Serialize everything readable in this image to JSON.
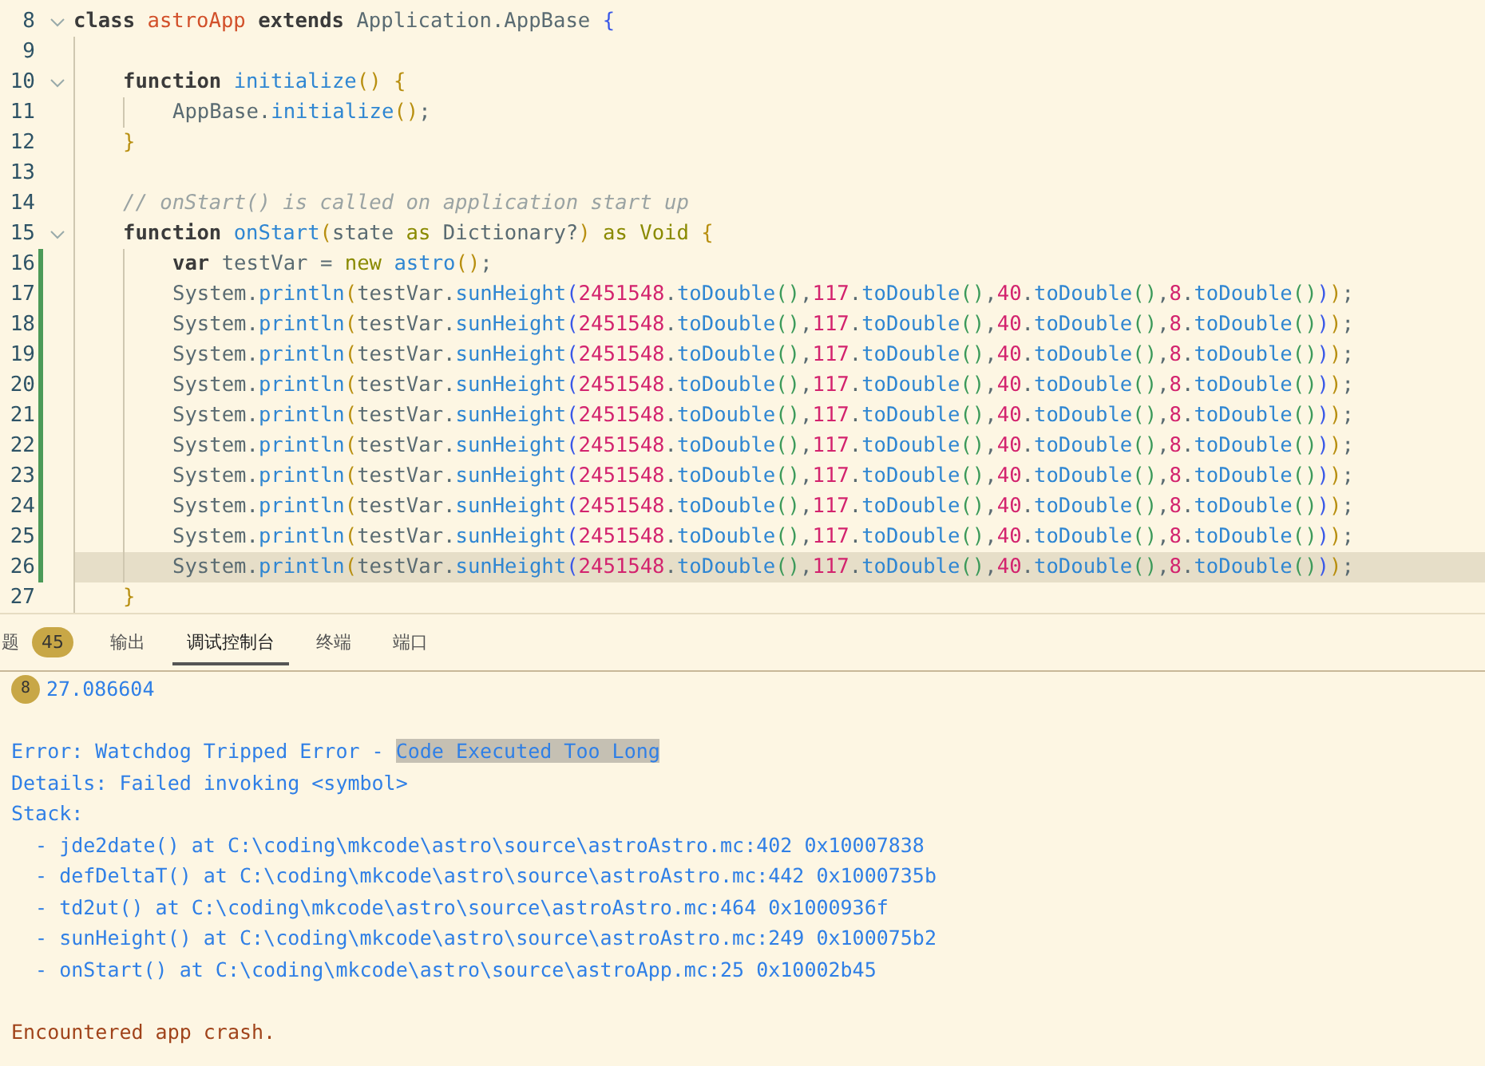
{
  "editor": {
    "lines": [
      {
        "number": "8",
        "fold": true,
        "modified": false,
        "current": false,
        "tokens": [
          {
            "text": "class ",
            "kind": "kw"
          },
          {
            "text": "astroApp ",
            "kind": "cls"
          },
          {
            "text": "extends",
            "kind": "kw"
          },
          {
            "text": " Application.AppBase ",
            "kind": "plain"
          },
          {
            "text": "{",
            "kind": "p2"
          }
        ],
        "children": [
          {
            "number": "9",
            "fold": false,
            "modified": false,
            "current": false
          },
          {
            "number": "10",
            "fold": true,
            "modified": false,
            "current": false,
            "tokens": [
              {
                "text": "function ",
                "kind": "kw"
              },
              {
                "text": "initialize",
                "kind": "fn"
              },
              {
                "text": "() {",
                "kind": "p1"
              }
            ],
            "children": [
              {
                "number": "11",
                "fold": false,
                "modified": false,
                "current": false,
                "tokens": [
                  {
                    "text": "AppBase.",
                    "kind": "plain"
                  },
                  {
                    "text": "initialize",
                    "kind": "fn"
                  },
                  {
                    "text": "()",
                    "kind": "p1"
                  },
                  {
                    "text": ";",
                    "kind": "plain"
                  }
                ]
              }
            ]
          },
          {
            "number": "12",
            "fold": false,
            "modified": false,
            "current": false,
            "tokens": [
              {
                "text": "}",
                "kind": "p1"
              }
            ]
          },
          {
            "number": "13",
            "fold": false,
            "modified": false,
            "current": false
          },
          {
            "number": "14",
            "fold": false,
            "modified": false,
            "current": false,
            "tokens": [
              {
                "text": "// onStart() is called on application start up",
                "kind": "comment"
              }
            ]
          },
          {
            "number": "15",
            "fold": true,
            "modified": false,
            "current": false,
            "tokens": [
              {
                "text": "function ",
                "kind": "kw"
              },
              {
                "text": "onStart",
                "kind": "fn"
              },
              {
                "text": "(",
                "kind": "p1"
              },
              {
                "text": "state ",
                "kind": "plain"
              },
              {
                "text": "as",
                "kind": "op"
              },
              {
                "text": " Dictionary?",
                "kind": "plain"
              },
              {
                "text": ")",
                "kind": "p1"
              },
              {
                "text": " as Void ",
                "kind": "op"
              },
              {
                "text": "{",
                "kind": "p1"
              }
            ],
            "children": [
              {
                "number": "16",
                "fold": false,
                "modified": true,
                "current": false,
                "tokens": [
                  {
                    "text": "var",
                    "kind": "kw"
                  },
                  {
                    "text": " testVar = ",
                    "kind": "plain"
                  },
                  {
                    "text": "new ",
                    "kind": "op"
                  },
                  {
                    "text": "astro",
                    "kind": "fn"
                  },
                  {
                    "text": "()",
                    "kind": "p1"
                  },
                  {
                    "text": ";",
                    "kind": "plain"
                  }
                ]
              },
              {
                "number": "17",
                "fold": false,
                "modified": true,
                "current": false,
                "tokens": [
                  {
                    "text": "System.",
                    "kind": "plain"
                  },
                  {
                    "text": "println",
                    "kind": "fn"
                  },
                  {
                    "text": "(",
                    "kind": "p1"
                  },
                  {
                    "text": "testVar.",
                    "kind": "plain"
                  },
                  {
                    "text": "sunHeight",
                    "kind": "fn"
                  },
                  {
                    "text": "(",
                    "kind": "p2"
                  },
                  {
                    "text": "2451548",
                    "kind": "num"
                  },
                  {
                    "text": ".",
                    "kind": "plain"
                  },
                  {
                    "text": "toDouble",
                    "kind": "fn"
                  },
                  {
                    "text": "()",
                    "kind": "p3"
                  },
                  {
                    "text": ",",
                    "kind": "plain"
                  },
                  {
                    "text": "117",
                    "kind": "num"
                  },
                  {
                    "text": ".",
                    "kind": "plain"
                  },
                  {
                    "text": "toDouble",
                    "kind": "fn"
                  },
                  {
                    "text": "()",
                    "kind": "p3"
                  },
                  {
                    "text": ",",
                    "kind": "plain"
                  },
                  {
                    "text": "40",
                    "kind": "num"
                  },
                  {
                    "text": ".",
                    "kind": "plain"
                  },
                  {
                    "text": "toDouble",
                    "kind": "fn"
                  },
                  {
                    "text": "()",
                    "kind": "p3"
                  },
                  {
                    "text": ",",
                    "kind": "plain"
                  },
                  {
                    "text": "8",
                    "kind": "num"
                  },
                  {
                    "text": ".",
                    "kind": "plain"
                  },
                  {
                    "text": "toDouble",
                    "kind": "fn"
                  },
                  {
                    "text": "()",
                    "kind": "p3"
                  },
                  {
                    "text": ")",
                    "kind": "p2"
                  },
                  {
                    "text": ")",
                    "kind": "p1"
                  },
                  {
                    "text": ";",
                    "kind": "plain"
                  }
                ]
              },
              {
                "number": "18",
                "fold": false,
                "modified": true,
                "current": false,
                "tokens": [
                  {
                    "text": "System.",
                    "kind": "plain"
                  },
                  {
                    "text": "println",
                    "kind": "fn"
                  },
                  {
                    "text": "(",
                    "kind": "p1"
                  },
                  {
                    "text": "testVar.",
                    "kind": "plain"
                  },
                  {
                    "text": "sunHeight",
                    "kind": "fn"
                  },
                  {
                    "text": "(",
                    "kind": "p2"
                  },
                  {
                    "text": "2451548",
                    "kind": "num"
                  },
                  {
                    "text": ".",
                    "kind": "plain"
                  },
                  {
                    "text": "toDouble",
                    "kind": "fn"
                  },
                  {
                    "text": "()",
                    "kind": "p3"
                  },
                  {
                    "text": ",",
                    "kind": "plain"
                  },
                  {
                    "text": "117",
                    "kind": "num"
                  },
                  {
                    "text": ".",
                    "kind": "plain"
                  },
                  {
                    "text": "toDouble",
                    "kind": "fn"
                  },
                  {
                    "text": "()",
                    "kind": "p3"
                  },
                  {
                    "text": ",",
                    "kind": "plain"
                  },
                  {
                    "text": "40",
                    "kind": "num"
                  },
                  {
                    "text": ".",
                    "kind": "plain"
                  },
                  {
                    "text": "toDouble",
                    "kind": "fn"
                  },
                  {
                    "text": "()",
                    "kind": "p3"
                  },
                  {
                    "text": ",",
                    "kind": "plain"
                  },
                  {
                    "text": "8",
                    "kind": "num"
                  },
                  {
                    "text": ".",
                    "kind": "plain"
                  },
                  {
                    "text": "toDouble",
                    "kind": "fn"
                  },
                  {
                    "text": "()",
                    "kind": "p3"
                  },
                  {
                    "text": ")",
                    "kind": "p2"
                  },
                  {
                    "text": ")",
                    "kind": "p1"
                  },
                  {
                    "text": ";",
                    "kind": "plain"
                  }
                ]
              },
              {
                "number": "19",
                "fold": false,
                "modified": true,
                "current": false,
                "tokens": [
                  {
                    "text": "System.",
                    "kind": "plain"
                  },
                  {
                    "text": "println",
                    "kind": "fn"
                  },
                  {
                    "text": "(",
                    "kind": "p1"
                  },
                  {
                    "text": "testVar.",
                    "kind": "plain"
                  },
                  {
                    "text": "sunHeight",
                    "kind": "fn"
                  },
                  {
                    "text": "(",
                    "kind": "p2"
                  },
                  {
                    "text": "2451548",
                    "kind": "num"
                  },
                  {
                    "text": ".",
                    "kind": "plain"
                  },
                  {
                    "text": "toDouble",
                    "kind": "fn"
                  },
                  {
                    "text": "()",
                    "kind": "p3"
                  },
                  {
                    "text": ",",
                    "kind": "plain"
                  },
                  {
                    "text": "117",
                    "kind": "num"
                  },
                  {
                    "text": ".",
                    "kind": "plain"
                  },
                  {
                    "text": "toDouble",
                    "kind": "fn"
                  },
                  {
                    "text": "()",
                    "kind": "p3"
                  },
                  {
                    "text": ",",
                    "kind": "plain"
                  },
                  {
                    "text": "40",
                    "kind": "num"
                  },
                  {
                    "text": ".",
                    "kind": "plain"
                  },
                  {
                    "text": "toDouble",
                    "kind": "fn"
                  },
                  {
                    "text": "()",
                    "kind": "p3"
                  },
                  {
                    "text": ",",
                    "kind": "plain"
                  },
                  {
                    "text": "8",
                    "kind": "num"
                  },
                  {
                    "text": ".",
                    "kind": "plain"
                  },
                  {
                    "text": "toDouble",
                    "kind": "fn"
                  },
                  {
                    "text": "()",
                    "kind": "p3"
                  },
                  {
                    "text": ")",
                    "kind": "p2"
                  },
                  {
                    "text": ")",
                    "kind": "p1"
                  },
                  {
                    "text": ";",
                    "kind": "plain"
                  }
                ]
              },
              {
                "number": "20",
                "fold": false,
                "modified": true,
                "current": false,
                "tokens": [
                  {
                    "text": "System.",
                    "kind": "plain"
                  },
                  {
                    "text": "println",
                    "kind": "fn"
                  },
                  {
                    "text": "(",
                    "kind": "p1"
                  },
                  {
                    "text": "testVar.",
                    "kind": "plain"
                  },
                  {
                    "text": "sunHeight",
                    "kind": "fn"
                  },
                  {
                    "text": "(",
                    "kind": "p2"
                  },
                  {
                    "text": "2451548",
                    "kind": "num"
                  },
                  {
                    "text": ".",
                    "kind": "plain"
                  },
                  {
                    "text": "toDouble",
                    "kind": "fn"
                  },
                  {
                    "text": "()",
                    "kind": "p3"
                  },
                  {
                    "text": ",",
                    "kind": "plain"
                  },
                  {
                    "text": "117",
                    "kind": "num"
                  },
                  {
                    "text": ".",
                    "kind": "plain"
                  },
                  {
                    "text": "toDouble",
                    "kind": "fn"
                  },
                  {
                    "text": "()",
                    "kind": "p3"
                  },
                  {
                    "text": ",",
                    "kind": "plain"
                  },
                  {
                    "text": "40",
                    "kind": "num"
                  },
                  {
                    "text": ".",
                    "kind": "plain"
                  },
                  {
                    "text": "toDouble",
                    "kind": "fn"
                  },
                  {
                    "text": "()",
                    "kind": "p3"
                  },
                  {
                    "text": ",",
                    "kind": "plain"
                  },
                  {
                    "text": "8",
                    "kind": "num"
                  },
                  {
                    "text": ".",
                    "kind": "plain"
                  },
                  {
                    "text": "toDouble",
                    "kind": "fn"
                  },
                  {
                    "text": "()",
                    "kind": "p3"
                  },
                  {
                    "text": ")",
                    "kind": "p2"
                  },
                  {
                    "text": ")",
                    "kind": "p1"
                  },
                  {
                    "text": ";",
                    "kind": "plain"
                  }
                ]
              },
              {
                "number": "21",
                "fold": false,
                "modified": true,
                "current": false,
                "tokens": [
                  {
                    "text": "System.",
                    "kind": "plain"
                  },
                  {
                    "text": "println",
                    "kind": "fn"
                  },
                  {
                    "text": "(",
                    "kind": "p1"
                  },
                  {
                    "text": "testVar.",
                    "kind": "plain"
                  },
                  {
                    "text": "sunHeight",
                    "kind": "fn"
                  },
                  {
                    "text": "(",
                    "kind": "p2"
                  },
                  {
                    "text": "2451548",
                    "kind": "num"
                  },
                  {
                    "text": ".",
                    "kind": "plain"
                  },
                  {
                    "text": "toDouble",
                    "kind": "fn"
                  },
                  {
                    "text": "()",
                    "kind": "p3"
                  },
                  {
                    "text": ",",
                    "kind": "plain"
                  },
                  {
                    "text": "117",
                    "kind": "num"
                  },
                  {
                    "text": ".",
                    "kind": "plain"
                  },
                  {
                    "text": "toDouble",
                    "kind": "fn"
                  },
                  {
                    "text": "()",
                    "kind": "p3"
                  },
                  {
                    "text": ",",
                    "kind": "plain"
                  },
                  {
                    "text": "40",
                    "kind": "num"
                  },
                  {
                    "text": ".",
                    "kind": "plain"
                  },
                  {
                    "text": "toDouble",
                    "kind": "fn"
                  },
                  {
                    "text": "()",
                    "kind": "p3"
                  },
                  {
                    "text": ",",
                    "kind": "plain"
                  },
                  {
                    "text": "8",
                    "kind": "num"
                  },
                  {
                    "text": ".",
                    "kind": "plain"
                  },
                  {
                    "text": "toDouble",
                    "kind": "fn"
                  },
                  {
                    "text": "()",
                    "kind": "p3"
                  },
                  {
                    "text": ")",
                    "kind": "p2"
                  },
                  {
                    "text": ")",
                    "kind": "p1"
                  },
                  {
                    "text": ";",
                    "kind": "plain"
                  }
                ]
              },
              {
                "number": "22",
                "fold": false,
                "modified": true,
                "current": false,
                "tokens": [
                  {
                    "text": "System.",
                    "kind": "plain"
                  },
                  {
                    "text": "println",
                    "kind": "fn"
                  },
                  {
                    "text": "(",
                    "kind": "p1"
                  },
                  {
                    "text": "testVar.",
                    "kind": "plain"
                  },
                  {
                    "text": "sunHeight",
                    "kind": "fn"
                  },
                  {
                    "text": "(",
                    "kind": "p2"
                  },
                  {
                    "text": "2451548",
                    "kind": "num"
                  },
                  {
                    "text": ".",
                    "kind": "plain"
                  },
                  {
                    "text": "toDouble",
                    "kind": "fn"
                  },
                  {
                    "text": "()",
                    "kind": "p3"
                  },
                  {
                    "text": ",",
                    "kind": "plain"
                  },
                  {
                    "text": "117",
                    "kind": "num"
                  },
                  {
                    "text": ".",
                    "kind": "plain"
                  },
                  {
                    "text": "toDouble",
                    "kind": "fn"
                  },
                  {
                    "text": "()",
                    "kind": "p3"
                  },
                  {
                    "text": ",",
                    "kind": "plain"
                  },
                  {
                    "text": "40",
                    "kind": "num"
                  },
                  {
                    "text": ".",
                    "kind": "plain"
                  },
                  {
                    "text": "toDouble",
                    "kind": "fn"
                  },
                  {
                    "text": "()",
                    "kind": "p3"
                  },
                  {
                    "text": ",",
                    "kind": "plain"
                  },
                  {
                    "text": "8",
                    "kind": "num"
                  },
                  {
                    "text": ".",
                    "kind": "plain"
                  },
                  {
                    "text": "toDouble",
                    "kind": "fn"
                  },
                  {
                    "text": "()",
                    "kind": "p3"
                  },
                  {
                    "text": ")",
                    "kind": "p2"
                  },
                  {
                    "text": ")",
                    "kind": "p1"
                  },
                  {
                    "text": ";",
                    "kind": "plain"
                  }
                ]
              },
              {
                "number": "23",
                "fold": false,
                "modified": true,
                "current": false,
                "tokens": [
                  {
                    "text": "System.",
                    "kind": "plain"
                  },
                  {
                    "text": "println",
                    "kind": "fn"
                  },
                  {
                    "text": "(",
                    "kind": "p1"
                  },
                  {
                    "text": "testVar.",
                    "kind": "plain"
                  },
                  {
                    "text": "sunHeight",
                    "kind": "fn"
                  },
                  {
                    "text": "(",
                    "kind": "p2"
                  },
                  {
                    "text": "2451548",
                    "kind": "num"
                  },
                  {
                    "text": ".",
                    "kind": "plain"
                  },
                  {
                    "text": "toDouble",
                    "kind": "fn"
                  },
                  {
                    "text": "()",
                    "kind": "p3"
                  },
                  {
                    "text": ",",
                    "kind": "plain"
                  },
                  {
                    "text": "117",
                    "kind": "num"
                  },
                  {
                    "text": ".",
                    "kind": "plain"
                  },
                  {
                    "text": "toDouble",
                    "kind": "fn"
                  },
                  {
                    "text": "()",
                    "kind": "p3"
                  },
                  {
                    "text": ",",
                    "kind": "plain"
                  },
                  {
                    "text": "40",
                    "kind": "num"
                  },
                  {
                    "text": ".",
                    "kind": "plain"
                  },
                  {
                    "text": "toDouble",
                    "kind": "fn"
                  },
                  {
                    "text": "()",
                    "kind": "p3"
                  },
                  {
                    "text": ",",
                    "kind": "plain"
                  },
                  {
                    "text": "8",
                    "kind": "num"
                  },
                  {
                    "text": ".",
                    "kind": "plain"
                  },
                  {
                    "text": "toDouble",
                    "kind": "fn"
                  },
                  {
                    "text": "()",
                    "kind": "p3"
                  },
                  {
                    "text": ")",
                    "kind": "p2"
                  },
                  {
                    "text": ")",
                    "kind": "p1"
                  },
                  {
                    "text": ";",
                    "kind": "plain"
                  }
                ]
              },
              {
                "number": "24",
                "fold": false,
                "modified": true,
                "current": false,
                "tokens": [
                  {
                    "text": "System.",
                    "kind": "plain"
                  },
                  {
                    "text": "println",
                    "kind": "fn"
                  },
                  {
                    "text": "(",
                    "kind": "p1"
                  },
                  {
                    "text": "testVar.",
                    "kind": "plain"
                  },
                  {
                    "text": "sunHeight",
                    "kind": "fn"
                  },
                  {
                    "text": "(",
                    "kind": "p2"
                  },
                  {
                    "text": "2451548",
                    "kind": "num"
                  },
                  {
                    "text": ".",
                    "kind": "plain"
                  },
                  {
                    "text": "toDouble",
                    "kind": "fn"
                  },
                  {
                    "text": "()",
                    "kind": "p3"
                  },
                  {
                    "text": ",",
                    "kind": "plain"
                  },
                  {
                    "text": "117",
                    "kind": "num"
                  },
                  {
                    "text": ".",
                    "kind": "plain"
                  },
                  {
                    "text": "toDouble",
                    "kind": "fn"
                  },
                  {
                    "text": "()",
                    "kind": "p3"
                  },
                  {
                    "text": ",",
                    "kind": "plain"
                  },
                  {
                    "text": "40",
                    "kind": "num"
                  },
                  {
                    "text": ".",
                    "kind": "plain"
                  },
                  {
                    "text": "toDouble",
                    "kind": "fn"
                  },
                  {
                    "text": "()",
                    "kind": "p3"
                  },
                  {
                    "text": ",",
                    "kind": "plain"
                  },
                  {
                    "text": "8",
                    "kind": "num"
                  },
                  {
                    "text": ".",
                    "kind": "plain"
                  },
                  {
                    "text": "toDouble",
                    "kind": "fn"
                  },
                  {
                    "text": "()",
                    "kind": "p3"
                  },
                  {
                    "text": ")",
                    "kind": "p2"
                  },
                  {
                    "text": ")",
                    "kind": "p1"
                  },
                  {
                    "text": ";",
                    "kind": "plain"
                  }
                ]
              },
              {
                "number": "25",
                "fold": false,
                "modified": true,
                "current": false,
                "tokens": [
                  {
                    "text": "System.",
                    "kind": "plain"
                  },
                  {
                    "text": "println",
                    "kind": "fn"
                  },
                  {
                    "text": "(",
                    "kind": "p1"
                  },
                  {
                    "text": "testVar.",
                    "kind": "plain"
                  },
                  {
                    "text": "sunHeight",
                    "kind": "fn"
                  },
                  {
                    "text": "(",
                    "kind": "p2"
                  },
                  {
                    "text": "2451548",
                    "kind": "num"
                  },
                  {
                    "text": ".",
                    "kind": "plain"
                  },
                  {
                    "text": "toDouble",
                    "kind": "fn"
                  },
                  {
                    "text": "()",
                    "kind": "p3"
                  },
                  {
                    "text": ",",
                    "kind": "plain"
                  },
                  {
                    "text": "117",
                    "kind": "num"
                  },
                  {
                    "text": ".",
                    "kind": "plain"
                  },
                  {
                    "text": "toDouble",
                    "kind": "fn"
                  },
                  {
                    "text": "()",
                    "kind": "p3"
                  },
                  {
                    "text": ",",
                    "kind": "plain"
                  },
                  {
                    "text": "40",
                    "kind": "num"
                  },
                  {
                    "text": ".",
                    "kind": "plain"
                  },
                  {
                    "text": "toDouble",
                    "kind": "fn"
                  },
                  {
                    "text": "()",
                    "kind": "p3"
                  },
                  {
                    "text": ",",
                    "kind": "plain"
                  },
                  {
                    "text": "8",
                    "kind": "num"
                  },
                  {
                    "text": ".",
                    "kind": "plain"
                  },
                  {
                    "text": "toDouble",
                    "kind": "fn"
                  },
                  {
                    "text": "()",
                    "kind": "p3"
                  },
                  {
                    "text": ")",
                    "kind": "p2"
                  },
                  {
                    "text": ")",
                    "kind": "p1"
                  },
                  {
                    "text": ";",
                    "kind": "plain"
                  }
                ]
              },
              {
                "number": "26",
                "fold": false,
                "modified": true,
                "current": true,
                "tokens": [
                  {
                    "text": "System.",
                    "kind": "plain"
                  },
                  {
                    "text": "println",
                    "kind": "fn"
                  },
                  {
                    "text": "(",
                    "kind": "p1"
                  },
                  {
                    "text": "testVar.",
                    "kind": "plain"
                  },
                  {
                    "text": "sunHeight",
                    "kind": "fn"
                  },
                  {
                    "text": "(",
                    "kind": "p2"
                  },
                  {
                    "text": "2451548",
                    "kind": "num"
                  },
                  {
                    "text": ".",
                    "kind": "plain"
                  },
                  {
                    "text": "toDouble",
                    "kind": "fn"
                  },
                  {
                    "text": "()",
                    "kind": "p3"
                  },
                  {
                    "text": ",",
                    "kind": "plain"
                  },
                  {
                    "text": "117",
                    "kind": "num"
                  },
                  {
                    "text": ".",
                    "kind": "plain"
                  },
                  {
                    "text": "toDouble",
                    "kind": "fn"
                  },
                  {
                    "text": "()",
                    "kind": "p3"
                  },
                  {
                    "text": ",",
                    "kind": "plain"
                  },
                  {
                    "text": "40",
                    "kind": "num"
                  },
                  {
                    "text": ".",
                    "kind": "plain"
                  },
                  {
                    "text": "toDouble",
                    "kind": "fn"
                  },
                  {
                    "text": "()",
                    "kind": "p3"
                  },
                  {
                    "text": ",",
                    "kind": "plain"
                  },
                  {
                    "text": "8",
                    "kind": "num"
                  },
                  {
                    "text": ".",
                    "kind": "plain"
                  },
                  {
                    "text": "toDouble",
                    "kind": "fn"
                  },
                  {
                    "text": "()",
                    "kind": "p3"
                  },
                  {
                    "text": ")",
                    "kind": "p2"
                  },
                  {
                    "text": ")",
                    "kind": "p1"
                  },
                  {
                    "text": ";",
                    "kind": "plain"
                  }
                ]
              }
            ]
          },
          {
            "number": "27",
            "fold": false,
            "modified": false,
            "current": false,
            "tokens": [
              {
                "text": "}",
                "kind": "p1"
              }
            ]
          }
        ]
      }
    ]
  },
  "panel": {
    "tabs": [
      {
        "label": "题",
        "badge": "45",
        "selected": false
      },
      {
        "label": "输出",
        "selected": false
      },
      {
        "label": "调试控制台",
        "selected": true
      },
      {
        "label": "终端",
        "selected": false
      },
      {
        "label": "端口",
        "selected": false
      }
    ],
    "console": [
      {
        "kind": "output",
        "count": "8",
        "text": "27.086604",
        "spaced": false
      },
      {
        "kind": "output",
        "text": "Error: Watchdog Tripped Error - ",
        "highlighted": "Code Executed Too Long",
        "spaced": true
      },
      {
        "kind": "output",
        "text": "Details: Failed invoking <symbol>",
        "spaced": false
      },
      {
        "kind": "output",
        "text": "Stack:",
        "spaced": false
      },
      {
        "kind": "output",
        "text": "  - jde2date() at C:\\coding\\mkcode\\astro\\source\\astroAstro.mc:402 0x10007838",
        "spaced": false
      },
      {
        "kind": "output",
        "text": "  - defDeltaT() at C:\\coding\\mkcode\\astro\\source\\astroAstro.mc:442 0x1000735b",
        "spaced": false
      },
      {
        "kind": "output",
        "text": "  - td2ut() at C:\\coding\\mkcode\\astro\\source\\astroAstro.mc:464 0x1000936f",
        "spaced": false
      },
      {
        "kind": "output",
        "text": "  - sunHeight() at C:\\coding\\mkcode\\astro\\source\\astroAstro.mc:249 0x100075b2",
        "spaced": false
      },
      {
        "kind": "output",
        "text": "  - onStart() at C:\\coding\\mkcode\\astro\\source\\astroApp.mc:25 0x10002b45",
        "spaced": false
      },
      {
        "kind": "crash",
        "text": "Encountered app crash.",
        "spaced": true
      }
    ]
  }
}
